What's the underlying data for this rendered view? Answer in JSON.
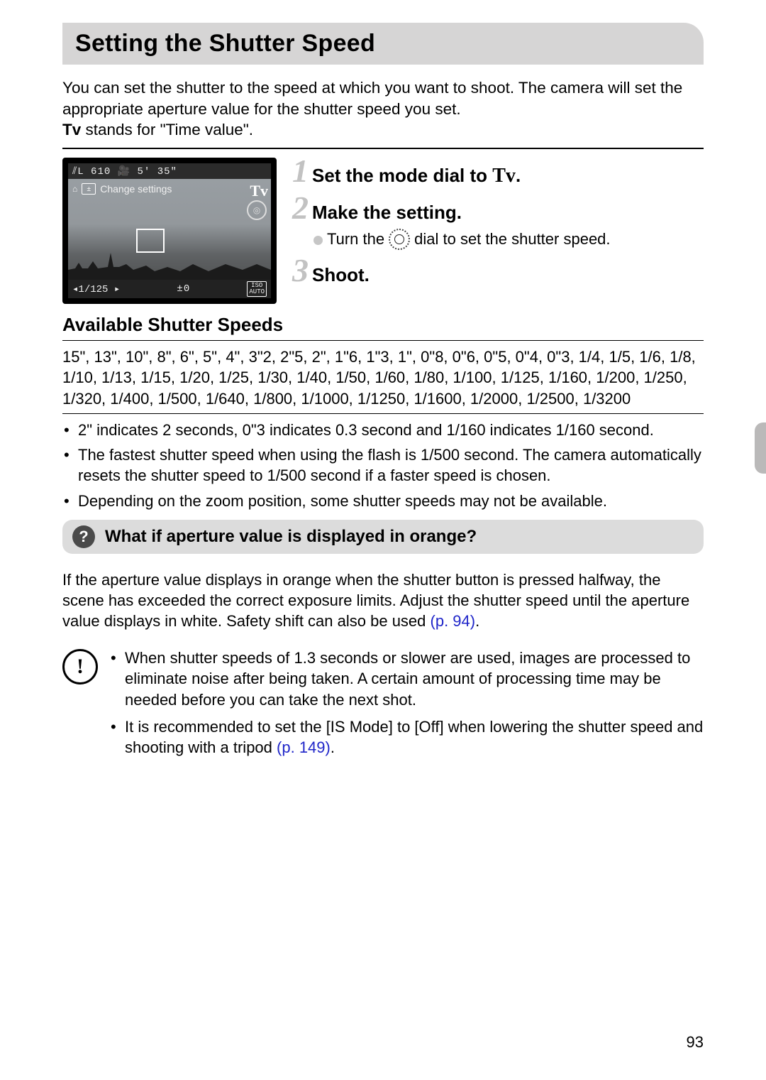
{
  "title": "Setting the Shutter Speed",
  "intro_line1": "You can set the shutter to the speed at which you want to shoot. The camera will set the appropriate aperture value for the shutter speed you set.",
  "intro_tv_abbr": "Tv",
  "intro_tv_rest": " stands for \"Time value\".",
  "lcd": {
    "top_readout": "⫽L 610  🎥 5' 35\"",
    "change_chip": "±",
    "change_text": "Change settings",
    "tv": "Tv",
    "shutter_value": "◂1/125 ▸",
    "ev": "±0",
    "iso": "ISO\nAUTO"
  },
  "steps": {
    "s1_num": "1",
    "s1_label_pre": "Set the mode dial to ",
    "s1_tv": "Tv",
    "s1_label_post": ".",
    "s2_num": "2",
    "s2_label": "Make the setting.",
    "s2_sub_pre": "Turn the ",
    "s2_sub_post": " dial to set the shutter speed.",
    "s3_num": "3",
    "s3_label": "Shoot."
  },
  "section_speeds_heading": "Available Shutter Speeds",
  "speeds_list": "15\", 13\", 10\", 8\", 6\", 5\", 4\", 3\"2, 2\"5, 2\", 1\"6, 1\"3, 1\", 0\"8, 0\"6, 0\"5, 0\"4, 0\"3, 1/4, 1/5, 1/6, 1/8, 1/10, 1/13, 1/15, 1/20, 1/25, 1/30, 1/40, 1/50, 1/60, 1/80, 1/100, 1/125, 1/160, 1/200, 1/250, 1/320, 1/400, 1/500, 1/640, 1/800, 1/1000, 1/1250, 1/1600, 1/2000, 1/2500, 1/3200",
  "notes": {
    "n1": "2\" indicates 2 seconds, 0\"3 indicates 0.3 second and 1/160 indicates 1/160 second.",
    "n2": "The fastest shutter speed when using the flash is 1/500 second. The camera automatically resets the shutter speed to 1/500 second if a faster speed is chosen.",
    "n3": "Depending on the zoom position, some shutter speeds may not be available."
  },
  "qmark": "?",
  "qbox_title": "What if aperture value is displayed in orange?",
  "q_body_text": "If the aperture value displays in orange when the shutter button is pressed halfway, the scene has exceeded the correct exposure limits. Adjust the shutter speed until the aperture value displays in white. Safety shift can also be used ",
  "q_body_link": "(p. 94)",
  "q_body_tail": ".",
  "alert_glyph": "!",
  "alerts": {
    "a1": "When shutter speeds of 1.3 seconds or slower are used, images are processed to eliminate noise after being taken. A certain amount of processing time may be needed before you can take the next shot.",
    "a2_pre": "It is recommended to set the [IS Mode] to [Off] when lowering the shutter speed and shooting with a tripod ",
    "a2_link": "(p. 149)",
    "a2_post": "."
  },
  "page_number": "93"
}
